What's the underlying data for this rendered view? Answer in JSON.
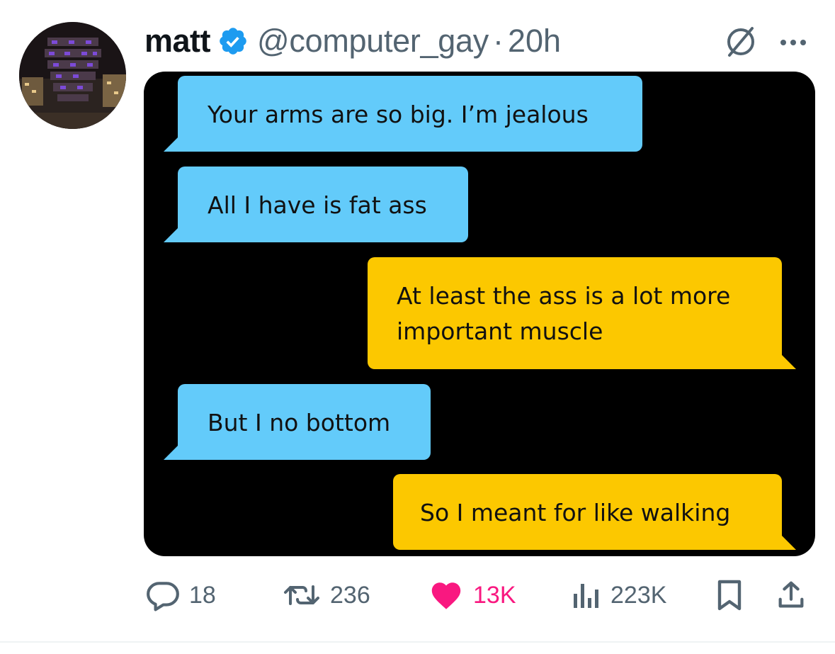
{
  "author": {
    "display_name": "matt",
    "handle": "@computer_gay",
    "separator": "·",
    "time": "20h",
    "verified": true
  },
  "media": {
    "messages": [
      {
        "side": "left",
        "color": "#63cbfa",
        "lines": [
          "Your arms are so big. I’m jealous"
        ]
      },
      {
        "side": "left",
        "color": "#63cbfa",
        "lines": [
          "All I have is fat ass"
        ]
      },
      {
        "side": "right",
        "color": "#fcc800",
        "lines": [
          "At least the ass is a lot more",
          "important muscle"
        ]
      },
      {
        "side": "left",
        "color": "#63cbfa",
        "lines": [
          "But I no bottom"
        ]
      },
      {
        "side": "right",
        "color": "#fcc800",
        "lines": [
          "So I meant for like walking"
        ]
      }
    ]
  },
  "actions": {
    "reply_count": "18",
    "retweet_count": "236",
    "like_count": "13K",
    "views_count": "223K"
  },
  "icons": {
    "verified": "verified-badge-icon",
    "grok": "grok-icon",
    "more": "more-icon",
    "reply": "reply-icon",
    "retweet": "retweet-icon",
    "like": "heart-icon",
    "views": "views-icon",
    "bookmark": "bookmark-icon",
    "share": "share-icon"
  },
  "colors": {
    "verified": "#1d9bf0",
    "like": "#f91880",
    "muted": "#536471",
    "blue_bubble": "#63cbfa",
    "yellow_bubble": "#fcc800"
  }
}
